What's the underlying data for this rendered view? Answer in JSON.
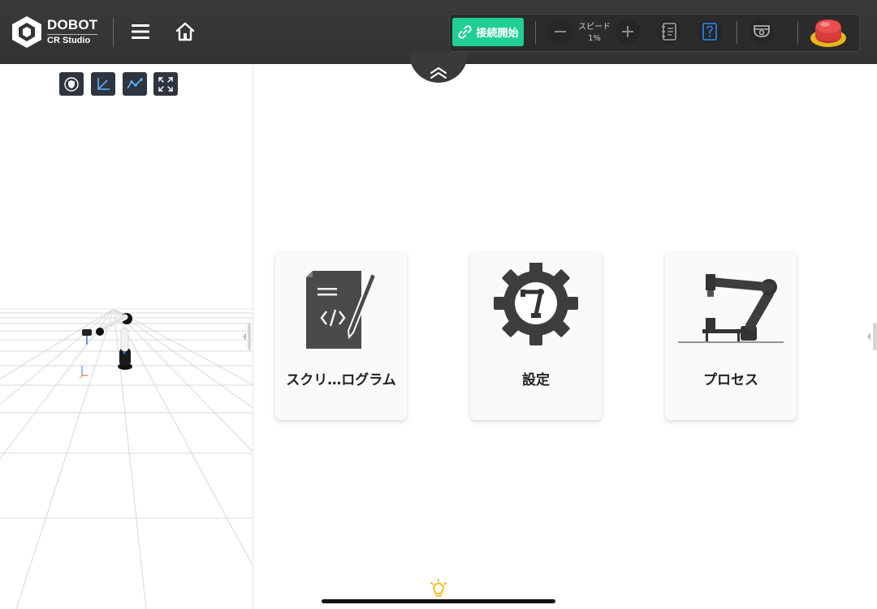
{
  "header": {
    "brand": "DOBOT",
    "product": "CR Studio",
    "connect_label": "接続開始",
    "speed_label": "スピード",
    "speed_value": "1%"
  },
  "cards": [
    {
      "label": "スクリ…ログラム",
      "icon": "script-document-icon"
    },
    {
      "label": "設定",
      "icon": "settings-gear-robot-icon"
    },
    {
      "label": "プロセス",
      "icon": "process-robot-arm-icon"
    }
  ],
  "colors": {
    "topbar": "#353535",
    "connect": "#1fcf93",
    "accent_blue": "#2a7de1",
    "estop": "#d93a3a",
    "estop_ring": "#e6b820",
    "bulb": "#f2b705"
  }
}
